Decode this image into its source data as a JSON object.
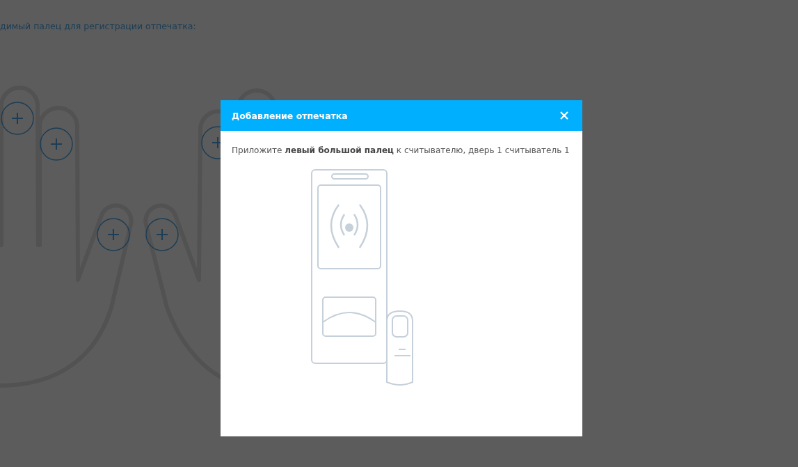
{
  "page": {
    "instruction": "димый палец для регистрации отпечатка:"
  },
  "dialog": {
    "title": "Добавление отпечатка",
    "message": "Приложите **левый большой палец** к считывателю, дверь 1 считыватель 1"
  }
}
